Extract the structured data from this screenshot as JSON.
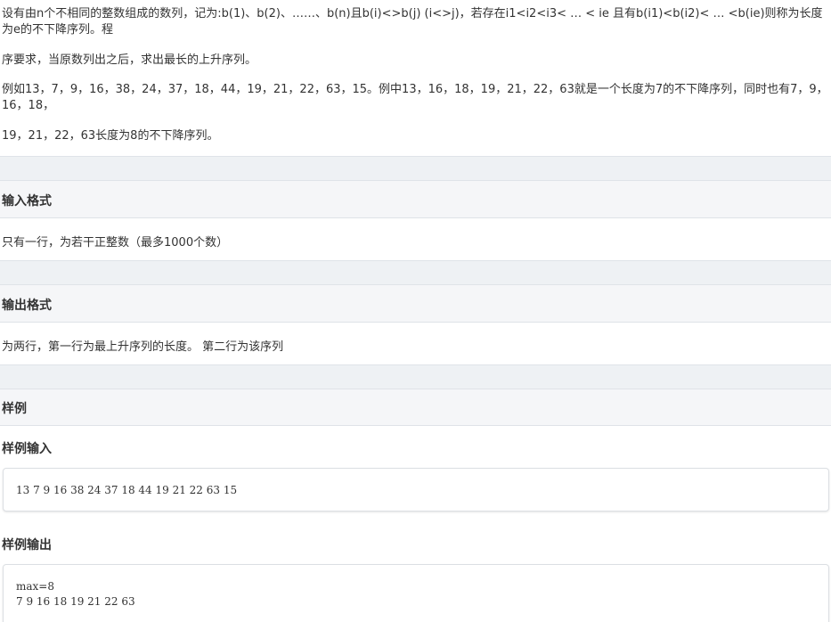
{
  "description": {
    "p1": "设有由n个不相同的整数组成的数列，记为:b(1)、b(2)、……、b(n)且b(i)<>b(j) (i<>j)，若存在i1<i2<i3< … < ie 且有b(i1)<b(i2)< … <b(ie)则称为长度为e的不下降序列。程",
    "p2": "序要求，当原数列出之后，求出最长的上升序列。",
    "p3": "例如13，7，9，16，38，24，37，18，44，19，21，22，63，15。例中13，16，18，19，21，22，63就是一个长度为7的不下降序列，同时也有7，9，16，18，",
    "p4": "19，21，22，63长度为8的不下降序列。"
  },
  "input_format": {
    "title": "输入格式",
    "body": "只有一行，为若干正整数（最多1000个数）"
  },
  "output_format": {
    "title": "输出格式",
    "body": "为两行，第一行为最上升序列的长度。 第二行为该序列"
  },
  "sample": {
    "title": "样例",
    "input_label": "样例输入",
    "input_code": "13 7 9 16 38 24 37 18 44 19 21 22 63 15",
    "output_label": "样例输出",
    "output_code": "max=8\n7 9 16 18 19 21 22 63"
  }
}
